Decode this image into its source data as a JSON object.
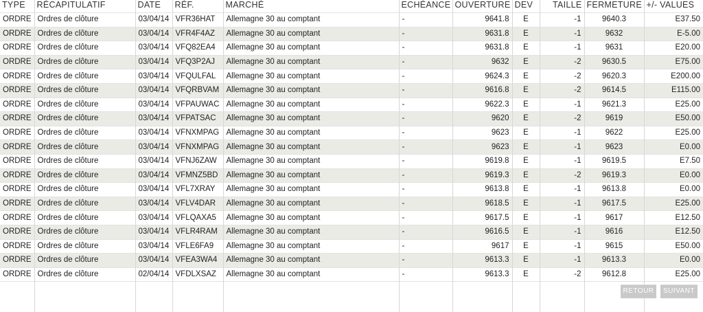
{
  "headers": [
    "TYPE",
    "RÉCAPITULATIF",
    "DATE",
    "RÉF.",
    "MARCHÉ",
    "ECHÉANCE",
    "OUVERTURE",
    "DEV",
    "TAILLE",
    "FERMETURE",
    "+/- VALUES"
  ],
  "rows": [
    [
      "ORDRE",
      "Ordres de clôture",
      "03/04/14",
      "VFR36HAT",
      "Allemagne 30 au comptant",
      "-",
      "9641.8",
      "E",
      "-1",
      "9640.3",
      "E37.50"
    ],
    [
      "ORDRE",
      "Ordres de clôture",
      "03/04/14",
      "VFR4F4AZ",
      "Allemagne 30 au comptant",
      "-",
      "9631.8",
      "E",
      "-1",
      "9632",
      "E-5.00"
    ],
    [
      "ORDRE",
      "Ordres de clôture",
      "03/04/14",
      "VFQ82EA4",
      "Allemagne 30 au comptant",
      "-",
      "9631.8",
      "E",
      "-1",
      "9631",
      "E20.00"
    ],
    [
      "ORDRE",
      "Ordres de clôture",
      "03/04/14",
      "VFQ3P2AJ",
      "Allemagne 30 au comptant",
      "-",
      "9632",
      "E",
      "-2",
      "9630.5",
      "E75.00"
    ],
    [
      "ORDRE",
      "Ordres de clôture",
      "03/04/14",
      "VFQULFAL",
      "Allemagne 30 au comptant",
      "-",
      "9624.3",
      "E",
      "-2",
      "9620.3",
      "E200.00"
    ],
    [
      "ORDRE",
      "Ordres de clôture",
      "03/04/14",
      "VFQRBVAM",
      "Allemagne 30 au comptant",
      "-",
      "9616.8",
      "E",
      "-2",
      "9614.5",
      "E115.00"
    ],
    [
      "ORDRE",
      "Ordres de clôture",
      "03/04/14",
      "VFPAUWAC",
      "Allemagne 30 au comptant",
      "-",
      "9622.3",
      "E",
      "-1",
      "9621.3",
      "E25.00"
    ],
    [
      "ORDRE",
      "Ordres de clôture",
      "03/04/14",
      "VFPATSAC",
      "Allemagne 30 au comptant",
      "-",
      "9620",
      "E",
      "-2",
      "9619",
      "E50.00"
    ],
    [
      "ORDRE",
      "Ordres de clôture",
      "03/04/14",
      "VFNXMPAG",
      "Allemagne 30 au comptant",
      "-",
      "9623",
      "E",
      "-1",
      "9622",
      "E25.00"
    ],
    [
      "ORDRE",
      "Ordres de clôture",
      "03/04/14",
      "VFNXMPAG",
      "Allemagne 30 au comptant",
      "-",
      "9623",
      "E",
      "-1",
      "9623",
      "E0.00"
    ],
    [
      "ORDRE",
      "Ordres de clôture",
      "03/04/14",
      "VFNJ6ZAW",
      "Allemagne 30 au comptant",
      "-",
      "9619.8",
      "E",
      "-1",
      "9619.5",
      "E7.50"
    ],
    [
      "ORDRE",
      "Ordres de clôture",
      "03/04/14",
      "VFMNZ5BD",
      "Allemagne 30 au comptant",
      "-",
      "9619.3",
      "E",
      "-2",
      "9619.3",
      "E0.00"
    ],
    [
      "ORDRE",
      "Ordres de clôture",
      "03/04/14",
      "VFL7XRAY",
      "Allemagne 30 au comptant",
      "-",
      "9613.8",
      "E",
      "-1",
      "9613.8",
      "E0.00"
    ],
    [
      "ORDRE",
      "Ordres de clôture",
      "03/04/14",
      "VFLV4DAR",
      "Allemagne 30 au comptant",
      "-",
      "9618.5",
      "E",
      "-1",
      "9617.5",
      "E25.00"
    ],
    [
      "ORDRE",
      "Ordres de clôture",
      "03/04/14",
      "VFLQAXA5",
      "Allemagne 30 au comptant",
      "-",
      "9617.5",
      "E",
      "-1",
      "9617",
      "E12.50"
    ],
    [
      "ORDRE",
      "Ordres de clôture",
      "03/04/14",
      "VFLR4RAM",
      "Allemagne 30 au comptant",
      "-",
      "9616.5",
      "E",
      "-1",
      "9616",
      "E12.50"
    ],
    [
      "ORDRE",
      "Ordres de clôture",
      "03/04/14",
      "VFLE6FA9",
      "Allemagne 30 au comptant",
      "-",
      "9617",
      "E",
      "-1",
      "9615",
      "E50.00"
    ],
    [
      "ORDRE",
      "Ordres de clôture",
      "03/04/14",
      "VFEA3WA4",
      "Allemagne 30 au comptant",
      "-",
      "9613.3",
      "E",
      "-1",
      "9613.3",
      "E0.00"
    ],
    [
      "ORDRE",
      "Ordres de clôture",
      "02/04/14",
      "VFDLXSAZ",
      "Allemagne 30 au comptant",
      "-",
      "9613.3",
      "E",
      "-2",
      "9612.8",
      "E25.00"
    ]
  ],
  "buttons": {
    "retour": "RETOUR",
    "suivant": "SUIVANT"
  }
}
